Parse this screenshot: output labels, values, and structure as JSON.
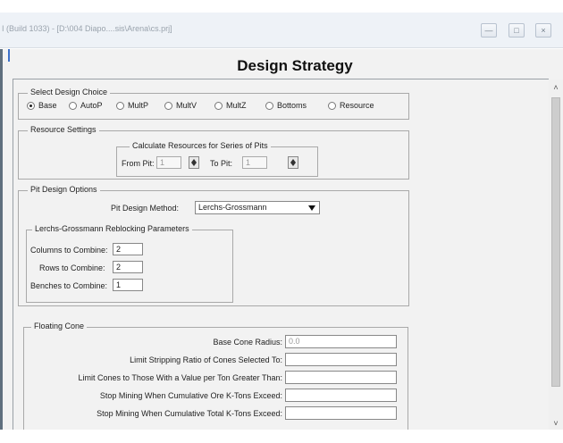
{
  "window": {
    "title": "I (Build 1033) - [D:\\004 Diapo....sis\\Arena\\cs.prj]",
    "minimize_glyph": "—",
    "maximize_glyph": "□",
    "close_glyph": "×"
  },
  "page": {
    "heading": "Design Strategy"
  },
  "design_choice": {
    "title": "Select Design Choice",
    "options": [
      "Base",
      "AutoP",
      "MultP",
      "MultV",
      "MultZ",
      "Bottoms",
      "Resource"
    ],
    "selected": "Base"
  },
  "resource_settings": {
    "title": "Resource Settings",
    "series_title": "Calculate Resources for Series of Pits",
    "from_label": "From Pit:",
    "from_value": "1",
    "to_label": "To Pit:",
    "to_value": "1"
  },
  "pit_design": {
    "title": "Pit Design Options",
    "method_label": "Pit Design Method:",
    "method_value": "Lerchs-Grossmann",
    "lg": {
      "title": "Lerchs-Grossmann Reblocking Parameters",
      "columns_label": "Columns to Combine:",
      "columns_value": "2",
      "rows_label": "Rows to Combine:",
      "rows_value": "2",
      "benches_label": "Benches to Combine:",
      "benches_value": "1"
    }
  },
  "floating_cone": {
    "title": "Floating Cone",
    "rows": [
      {
        "label": "Base Cone Radius:",
        "value": "0.0"
      },
      {
        "label": "Limit Stripping Ratio of Cones Selected To:",
        "value": ""
      },
      {
        "label": "Limit Cones to Those With a Value per Ton Greater Than:",
        "value": ""
      },
      {
        "label": "Stop Mining When Cumulative Ore K-Tons Exceed:",
        "value": ""
      },
      {
        "label": "Stop Mining When Cumulative Total K-Tons Exceed:",
        "value": ""
      }
    ]
  },
  "scrollbar": {
    "up_glyph": "˄",
    "down_glyph": "˅"
  }
}
